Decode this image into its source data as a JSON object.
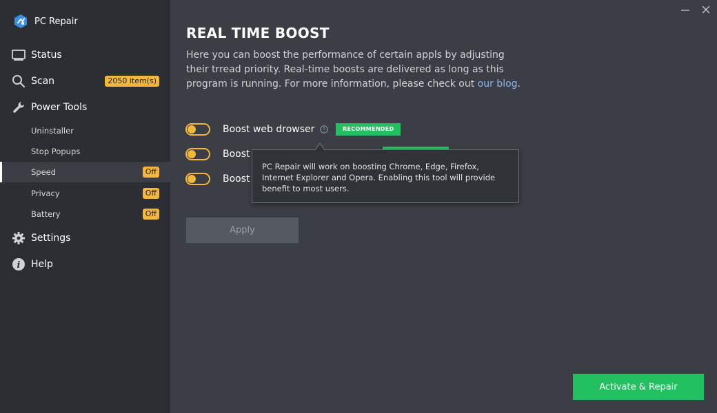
{
  "app": {
    "name": "PC Repair"
  },
  "window": {
    "minimize_icon": "minimize-icon",
    "close_icon": "close-icon"
  },
  "sidebar": {
    "items": [
      {
        "label": "Status",
        "icon": "monitor-icon"
      },
      {
        "label": "Scan",
        "icon": "search-icon",
        "badge": "2050 item(s)"
      },
      {
        "label": "Power Tools",
        "icon": "wrench-icon"
      },
      {
        "label": "Uninstaller"
      },
      {
        "label": "Stop Popups"
      },
      {
        "label": "Speed",
        "badge": "Off",
        "active": true
      },
      {
        "label": "Privacy",
        "badge": "Off"
      },
      {
        "label": "Battery",
        "badge": "Off"
      },
      {
        "label": "Settings",
        "icon": "gear-icon"
      },
      {
        "label": "Help",
        "icon": "info-icon"
      }
    ]
  },
  "main": {
    "title": "REAL TIME BOOST",
    "description": "Here you can boost the performance of certain appls by adjusting their trread priority. Real-time boosts are delivered as long as this program is running. For more information, please check out ",
    "blog_link": "our blog",
    "description_end": ".",
    "options": [
      {
        "label": "Boost web drowser",
        "badge": "RECOMMENDED",
        "enabled": false
      },
      {
        "label": "Boost",
        "enabled": false
      },
      {
        "label": "Boost",
        "enabled": false
      }
    ],
    "tooltip": "PC Repair will work on boosting Chrome, Edge, Firefox, Internet Explorer and Opera. Enabling this tool will provide benefit to most users.",
    "apply_label": "Apply",
    "activate_label": "Activate & Repair"
  },
  "colors": {
    "accent_green": "#22c060",
    "accent_orange": "#f4b73a",
    "sidebar_bg": "#2b2e33",
    "main_bg": "#3b3e44",
    "link": "#88b7f0"
  }
}
